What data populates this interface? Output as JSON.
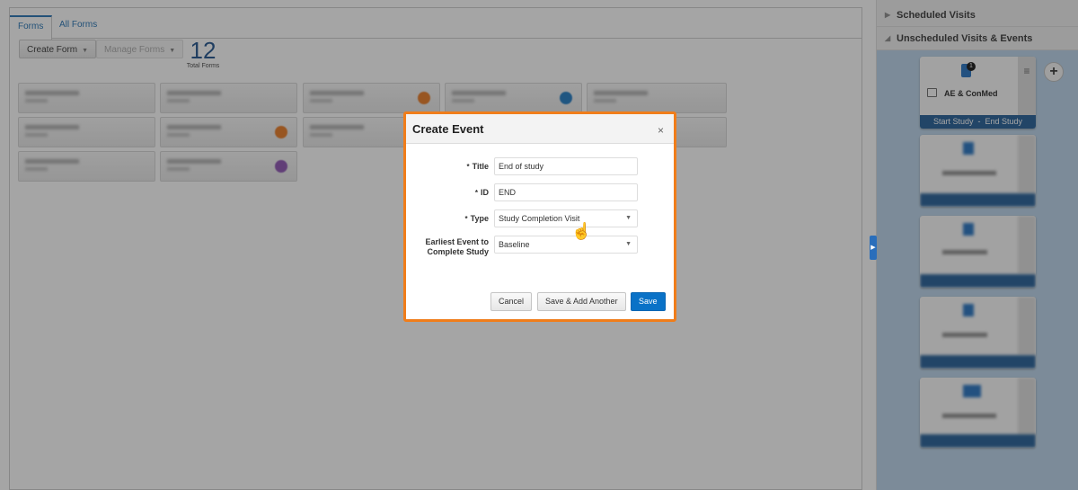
{
  "tabs": [
    {
      "label": "Forms",
      "active": true
    },
    {
      "label": "All Forms"
    }
  ],
  "toolbar": {
    "create_form": "Create Form",
    "manage_forms": "Manage Forms"
  },
  "total": {
    "count": "12",
    "label": "Total Forms"
  },
  "form_card_dot_colors": [
    "#e8771e",
    "#1b78c2",
    "#e8771e",
    "#8a4fb0"
  ],
  "right_panel": {
    "scheduled": "Scheduled Visits",
    "unscheduled": "Unscheduled Visits & Events",
    "add_button": "+",
    "first_event": {
      "name": "AE & ConMed",
      "badge": "1",
      "footer_start": "Start Study",
      "footer_sep": "-",
      "footer_end": "End Study"
    }
  },
  "modal": {
    "title": "Create Event",
    "close": "×",
    "fields": [
      {
        "label": "Title",
        "required": true,
        "value": "End of study"
      },
      {
        "label": "ID",
        "required": true,
        "value": "END"
      },
      {
        "label": "Type",
        "required": true,
        "value": "Study Completion Visit"
      },
      {
        "label": "Earliest Event to Complete Study",
        "required": false,
        "value": "Baseline"
      }
    ],
    "cancel": "Cancel",
    "save_add": "Save & Add Another",
    "save": "Save"
  },
  "colors": {
    "accent": "#0a72c7",
    "modal_border": "#f07d1a",
    "event_footer": "#1e5b95"
  }
}
